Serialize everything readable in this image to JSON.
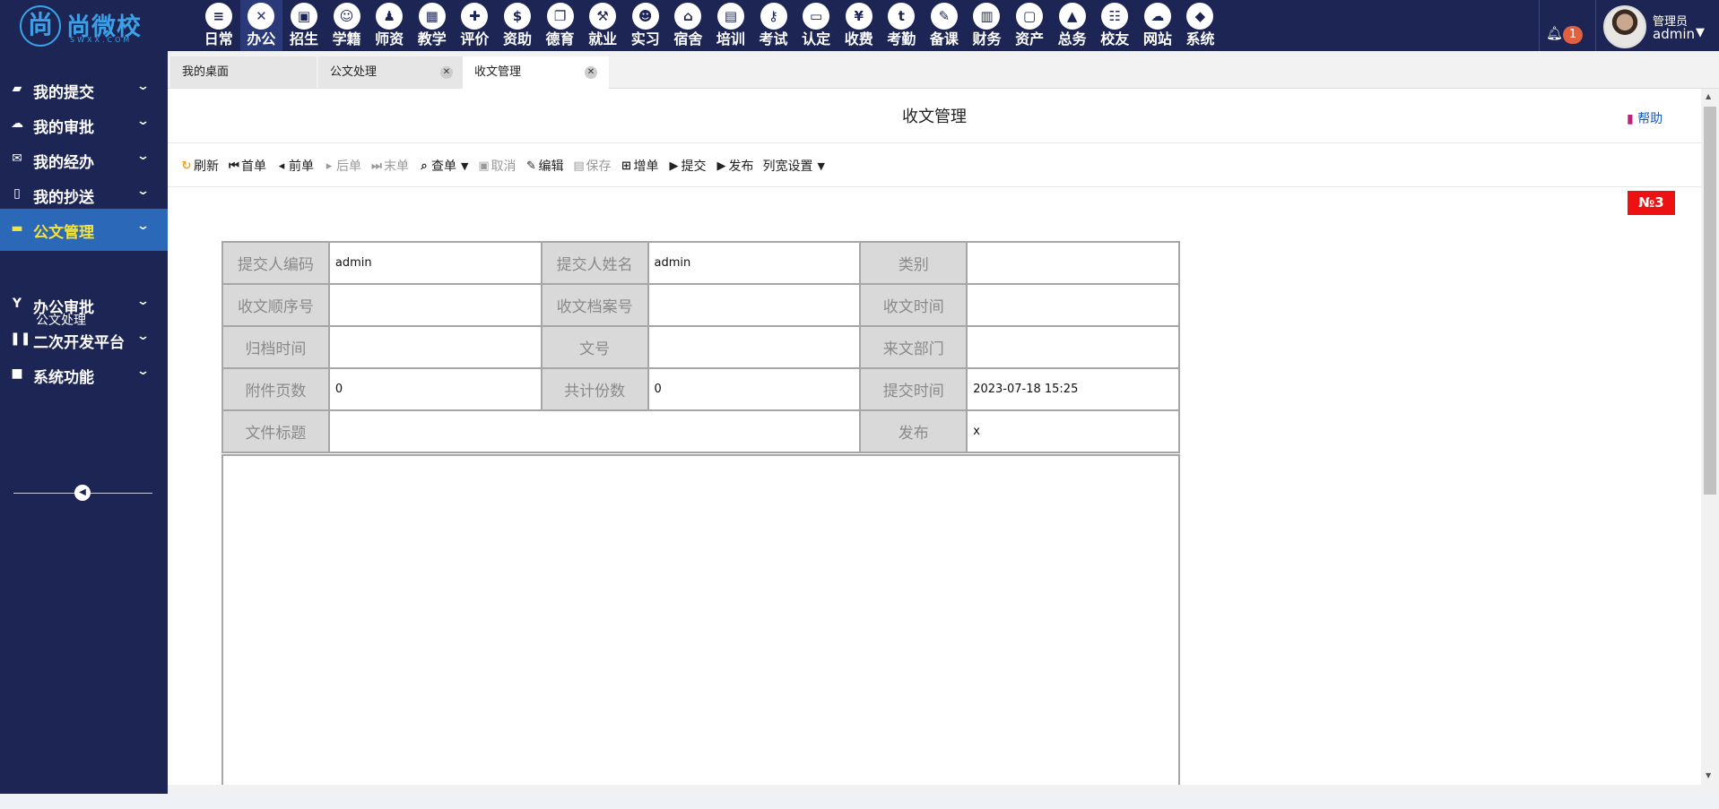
{
  "brand": {
    "logo_char": "尚",
    "name": "尚微校",
    "sub": "SWXX.COM"
  },
  "modules": [
    {
      "label": "日常",
      "icon": "document-icon",
      "glyph": "≡"
    },
    {
      "label": "办公",
      "icon": "office-icon",
      "glyph": "✕",
      "active": true
    },
    {
      "label": "招生",
      "icon": "bus-icon",
      "glyph": "▣"
    },
    {
      "label": "学籍",
      "icon": "student-icon",
      "glyph": "☺"
    },
    {
      "label": "师资",
      "icon": "teacher-icon",
      "glyph": "♟"
    },
    {
      "label": "教学",
      "icon": "calendar-icon",
      "glyph": "▦"
    },
    {
      "label": "评价",
      "icon": "calendar-plus-icon",
      "glyph": "✚"
    },
    {
      "label": "资助",
      "icon": "funding-icon",
      "glyph": "$"
    },
    {
      "label": "德育",
      "icon": "book-icon",
      "glyph": "❐"
    },
    {
      "label": "就业",
      "icon": "gavel-icon",
      "glyph": "⚒"
    },
    {
      "label": "实习",
      "icon": "internship-icon",
      "glyph": "☻"
    },
    {
      "label": "宿舍",
      "icon": "home-icon",
      "glyph": "⌂"
    },
    {
      "label": "培训",
      "icon": "image-icon",
      "glyph": "▤"
    },
    {
      "label": "考试",
      "icon": "key-icon",
      "glyph": "⚷"
    },
    {
      "label": "认定",
      "icon": "monitor-icon",
      "glyph": "▭"
    },
    {
      "label": "收费",
      "icon": "yen-icon",
      "glyph": "¥"
    },
    {
      "label": "考勤",
      "icon": "attendance-icon",
      "glyph": "t"
    },
    {
      "label": "备课",
      "icon": "edit-icon",
      "glyph": "✎"
    },
    {
      "label": "财务",
      "icon": "newspaper-icon",
      "glyph": "▥"
    },
    {
      "label": "资产",
      "icon": "train-icon",
      "glyph": "▢"
    },
    {
      "label": "总务",
      "icon": "chart-icon",
      "glyph": "▲"
    },
    {
      "label": "校友",
      "icon": "users-icon",
      "glyph": "☷"
    },
    {
      "label": "网站",
      "icon": "cloud-icon",
      "glyph": "☁"
    },
    {
      "label": "系统",
      "icon": "cube-icon",
      "glyph": "◆"
    }
  ],
  "user": {
    "role": "管理员",
    "name": "admin",
    "notification_count": "1"
  },
  "sidebar": {
    "items": [
      {
        "label": "我的提交",
        "icon": "book-icon",
        "glyph": "▰"
      },
      {
        "label": "我的审批",
        "icon": "cloud-icon",
        "glyph": "☁"
      },
      {
        "label": "我的经办",
        "icon": "envelope-icon",
        "glyph": "✉"
      },
      {
        "label": "我的抄送",
        "icon": "file-icon",
        "glyph": "▯"
      },
      {
        "label": "公文管理",
        "icon": "folder-icon",
        "glyph": "▬",
        "active": true
      },
      {
        "label": "办公审批",
        "icon": "approval-icon",
        "glyph": "Y"
      },
      {
        "label": "二次开发平台",
        "icon": "columns-icon",
        "glyph": "❚❚"
      },
      {
        "label": "系统功能",
        "icon": "square-icon",
        "glyph": "■"
      }
    ],
    "sub_item": "公文处理"
  },
  "tabs": [
    {
      "label": "我的桌面",
      "closable": false
    },
    {
      "label": "公文处理",
      "closable": true
    },
    {
      "label": "收文管理",
      "closable": true,
      "active": true
    }
  ],
  "page": {
    "title": "收文管理",
    "help": "帮助",
    "record_no": "№3"
  },
  "toolbar": [
    {
      "label": "刷新",
      "icon": "refresh-icon",
      "glyph": "↻"
    },
    {
      "label": "首单",
      "icon": "first-icon",
      "glyph": "⏮"
    },
    {
      "label": "前单",
      "icon": "prev-icon",
      "glyph": "◂"
    },
    {
      "label": "后单",
      "icon": "next-icon",
      "glyph": "▸",
      "disabled": true
    },
    {
      "label": "末单",
      "icon": "last-icon",
      "glyph": "⏭",
      "disabled": true
    },
    {
      "label": "查单",
      "icon": "search-icon",
      "glyph": "⌕",
      "caret": true
    },
    {
      "label": "取消",
      "icon": "cancel-icon",
      "glyph": "▣",
      "disabled": true
    },
    {
      "label": "编辑",
      "icon": "edit-icon",
      "glyph": "✎"
    },
    {
      "label": "保存",
      "icon": "save-icon",
      "glyph": "▤",
      "disabled": true
    },
    {
      "label": "增单",
      "icon": "plus-square-icon",
      "glyph": "⊞"
    },
    {
      "label": "提交",
      "icon": "submit-icon",
      "glyph": "▶"
    },
    {
      "label": "发布",
      "icon": "publish-icon",
      "glyph": "▶"
    },
    {
      "label": "列宽设置",
      "icon": "",
      "glyph": "",
      "caret": true
    }
  ],
  "form": {
    "submitter_code_label": "提交人编码",
    "submitter_code": "admin",
    "submitter_name_label": "提交人姓名",
    "submitter_name": "admin",
    "category_label": "类别",
    "category": "",
    "seq_label": "收文顺序号",
    "seq": "",
    "archive_no_label": "收文档案号",
    "archive_no": "",
    "receive_time_label": "收文时间",
    "receive_time": "",
    "file_time_label": "归档时间",
    "file_time": "",
    "doc_no_label": "文号",
    "doc_no": "",
    "from_dept_label": "来文部门",
    "from_dept": "",
    "attach_pages_label": "附件页数",
    "attach_pages": "0",
    "copies_label": "共计份数",
    "copies": "0",
    "submit_time_label": "提交时间",
    "submit_time": "2023-07-18 15:25",
    "doc_title_label": "文件标题",
    "doc_title": "",
    "publish_label": "发布",
    "publish": "x"
  }
}
